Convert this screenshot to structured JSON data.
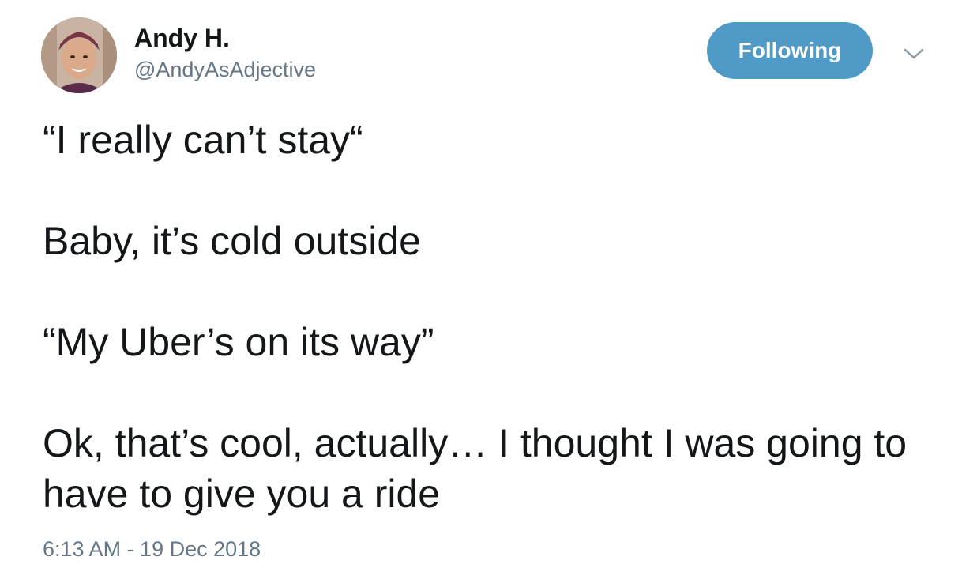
{
  "author": {
    "display_name": "Andy H.",
    "handle": "@AndyAsAdjective",
    "avatar_icon": "user-avatar-photo"
  },
  "actions": {
    "follow_label": "Following",
    "follow_color": "#4f9ac6",
    "menu_icon": "chevron-down-icon"
  },
  "tweet": {
    "line1": "“I really can’t stay“",
    "line2": "Baby, it’s cold outside",
    "line3": "“My Uber’s on its way”",
    "line4": "Ok, that’s cool, actually… I thought I was going to have to give you a ride"
  },
  "meta": {
    "timestamp": "6:13 AM - 19 Dec 2018"
  }
}
